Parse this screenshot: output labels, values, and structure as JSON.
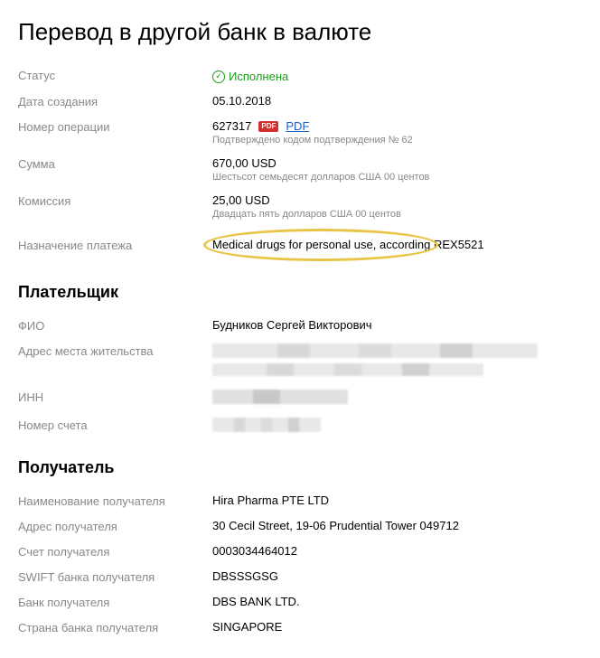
{
  "title": "Перевод в другой банк в валюте",
  "fields": {
    "status": {
      "label": "Статус",
      "value": "Исполнена"
    },
    "created": {
      "label": "Дата создания",
      "value": "05.10.2018"
    },
    "operation": {
      "label": "Номер операции",
      "value": "627317",
      "pdf_label": "PDF",
      "pdf_link": "PDF",
      "sub": "Подтверждено кодом подтверждения № 62"
    },
    "amount": {
      "label": "Сумма",
      "value": "670,00 USD",
      "sub": "Шестьсот семьдесят долларов США 00 центов"
    },
    "commission": {
      "label": "Комиссия",
      "value": "25,00 USD",
      "sub": "Двадцать пять долларов США 00 центов"
    },
    "purpose": {
      "label": "Назначение платежа",
      "value": "Medical drugs for personal use, according REX5521"
    }
  },
  "payer": {
    "heading": "Плательщик",
    "fio": {
      "label": "ФИО",
      "value": "Будников Сергей Викторович"
    },
    "address": {
      "label": "Адрес места жительства"
    },
    "inn": {
      "label": "ИНН"
    },
    "account": {
      "label": "Номер счета"
    }
  },
  "receiver": {
    "heading": "Получатель",
    "name": {
      "label": "Наименование получателя",
      "value": "Hira Pharma PTE LTD"
    },
    "address": {
      "label": "Адрес получателя",
      "value": "30 Cecil Street, 19-06 Prudential Tower 049712"
    },
    "account": {
      "label": "Счет получателя",
      "value": "0003034464012"
    },
    "swift": {
      "label": "SWIFT банка получателя",
      "value": "DBSSSGSG"
    },
    "bank": {
      "label": "Банк получателя",
      "value": "DBS BANK LTD."
    },
    "country": {
      "label": "Страна банка получателя",
      "value": "SINGAPORE"
    }
  }
}
